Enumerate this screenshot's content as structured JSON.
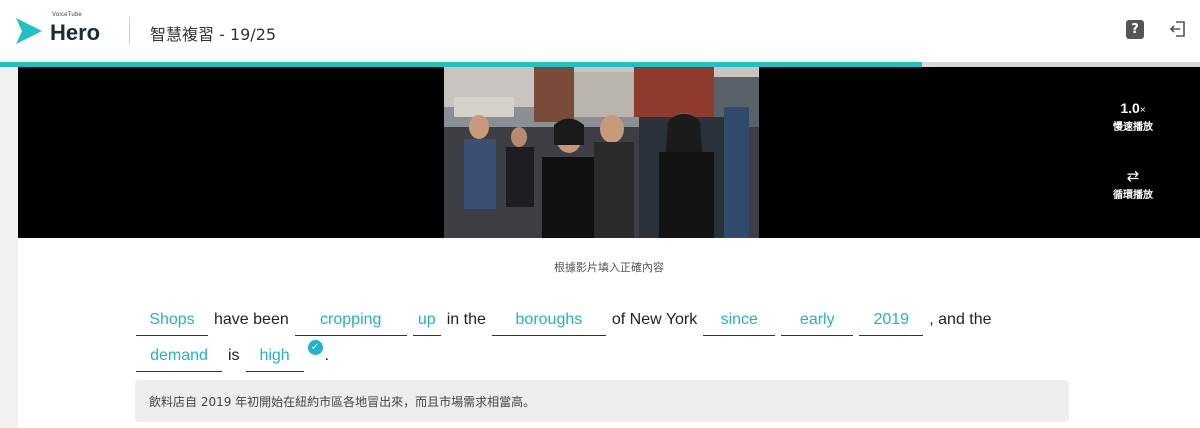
{
  "header": {
    "brand_small": "VoiceTube",
    "brand": "Hero",
    "title": "智慧複習 - 19/25",
    "help_icon": "question-mark-icon",
    "exit_icon": "exit-icon"
  },
  "progress": {
    "fraction": 0.768
  },
  "video": {
    "speed_value": "1.0",
    "speed_unit": "×",
    "speed_label": "慢速播放",
    "loop_icon": "loop-icon",
    "loop_label": "循環播放"
  },
  "exercise": {
    "instruction": "根據影片填入正確內容",
    "line1": [
      {
        "type": "blank",
        "text": "Shops",
        "w": 72
      },
      {
        "type": "word",
        "text": "have been"
      },
      {
        "type": "blank",
        "text": "cropping",
        "w": 112
      },
      {
        "type": "blank",
        "text": "up",
        "w": 28
      },
      {
        "type": "word",
        "text": "in the"
      },
      {
        "type": "blank",
        "text": "boroughs",
        "w": 114
      },
      {
        "type": "word",
        "text": "of New York"
      },
      {
        "type": "blank",
        "text": "since",
        "w": 72
      },
      {
        "type": "blank",
        "text": "early",
        "w": 72
      },
      {
        "type": "blank",
        "text": "2019",
        "w": 64
      },
      {
        "type": "word",
        "text": ", and the"
      }
    ],
    "line2": [
      {
        "type": "blank",
        "text": "demand",
        "w": 86
      },
      {
        "type": "word",
        "text": "is"
      },
      {
        "type": "blank",
        "text": "high",
        "w": 58
      },
      {
        "type": "check"
      },
      {
        "type": "period",
        "text": "."
      }
    ],
    "translation": "飲料店自 2019 年初開始在紐約市區各地冒出來，而且市場需求相當高。"
  },
  "colors": {
    "accent": "#1fc2c4",
    "accent_text": "#1fb4c7"
  }
}
